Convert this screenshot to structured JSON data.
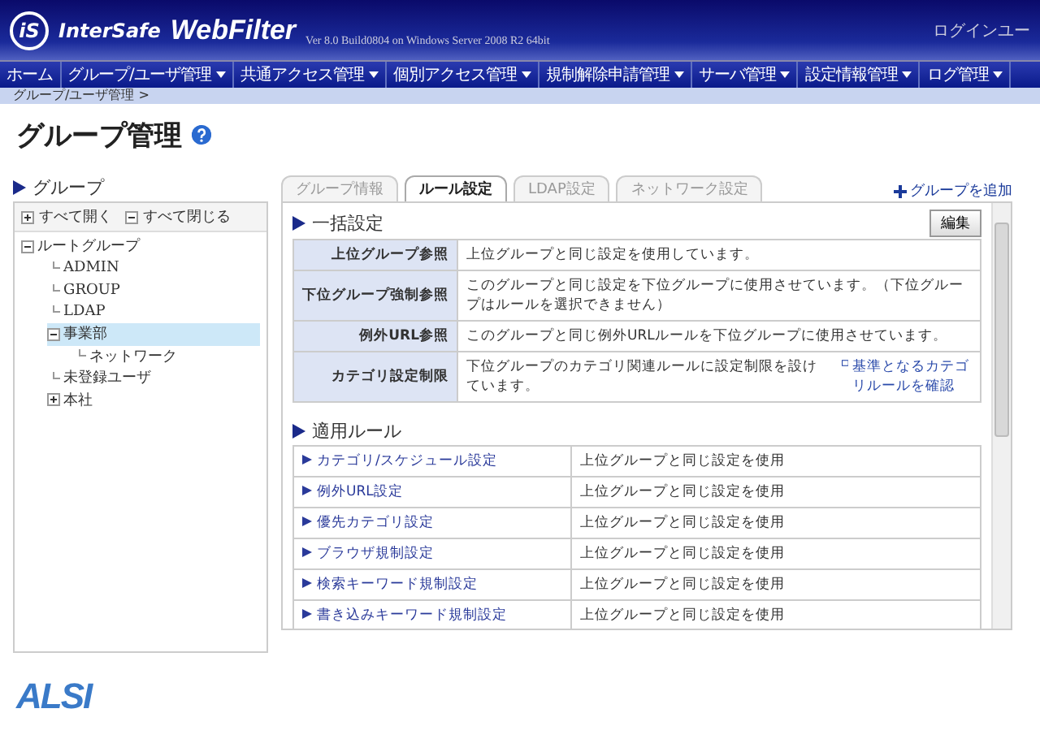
{
  "header": {
    "logo_prefix": "iS",
    "logo_name": "InterSafe",
    "logo_product": "WebFilter",
    "version": "Ver 8.0 Build0804 on Windows Server 2008 R2 64bit",
    "login_user": "ログインユー"
  },
  "nav": [
    {
      "label": "ホーム",
      "dropdown": false
    },
    {
      "label": "グループ/ユーザ管理",
      "dropdown": true
    },
    {
      "label": "共通アクセス管理",
      "dropdown": true
    },
    {
      "label": "個別アクセス管理",
      "dropdown": true
    },
    {
      "label": "規制解除申請管理",
      "dropdown": true
    },
    {
      "label": "サーバ管理",
      "dropdown": true
    },
    {
      "label": "設定情報管理",
      "dropdown": true
    },
    {
      "label": "ログ管理",
      "dropdown": true
    }
  ],
  "breadcrumb": "グループ/ユーザ管理 >",
  "page_title": "グループ管理",
  "sidebar": {
    "title": "グループ",
    "expand_all": "すべて開く",
    "collapse_all": "すべて閉じる",
    "tree": [
      {
        "label": "ルートグループ",
        "expanded": true,
        "selected": false,
        "children": [
          {
            "label": "ADMIN",
            "selected": false
          },
          {
            "label": "GROUP",
            "selected": false
          },
          {
            "label": "LDAP",
            "selected": false
          },
          {
            "label": "事業部",
            "expanded": true,
            "selected": true,
            "children": [
              {
                "label": "ネットワーク",
                "selected": false
              }
            ]
          },
          {
            "label": "未登録ユーザ",
            "selected": false
          },
          {
            "label": "本社",
            "expanded": false,
            "has_children": true,
            "selected": false
          }
        ]
      }
    ]
  },
  "tabs": [
    {
      "label": "グループ情報",
      "selected": false
    },
    {
      "label": "ルール設定",
      "selected": true
    },
    {
      "label": "LDAP設定",
      "selected": false
    },
    {
      "label": "ネットワーク設定",
      "selected": false
    }
  ],
  "add_group": "グループを追加",
  "bulk": {
    "title": "一括設定",
    "edit_button": "編集",
    "rows": [
      {
        "label": "上位グループ参照",
        "text": "上位グループと同じ設定を使用しています。"
      },
      {
        "label": "下位グループ強制参照",
        "text": "このグループと同じ設定を下位グループに使用させています。（下位グループはルールを選択できません）"
      },
      {
        "label": "例外URL参照",
        "text": "このグループと同じ例外URLルールを下位グループに使用させています。"
      },
      {
        "label": "カテゴリ設定制限",
        "text": "下位グループのカテゴリ関連ルールに設定制限を設けています。",
        "link": "基準となるカテゴリルールを確認"
      }
    ]
  },
  "rules": {
    "title": "適用ルール",
    "rows": [
      {
        "name": "カテゴリ/スケジュール設定",
        "value": "上位グループと同じ設定を使用"
      },
      {
        "name": "例外URL設定",
        "value": "上位グループと同じ設定を使用"
      },
      {
        "name": "優先カテゴリ設定",
        "value": "上位グループと同じ設定を使用"
      },
      {
        "name": "ブラウザ規制設定",
        "value": "上位グループと同じ設定を使用"
      },
      {
        "name": "検索キーワード規制設定",
        "value": "上位グループと同じ設定を使用"
      },
      {
        "name": "書き込みキーワード規制設定",
        "value": "上位グループと同じ設定を使用"
      }
    ]
  },
  "footer_logo": "ALSI"
}
